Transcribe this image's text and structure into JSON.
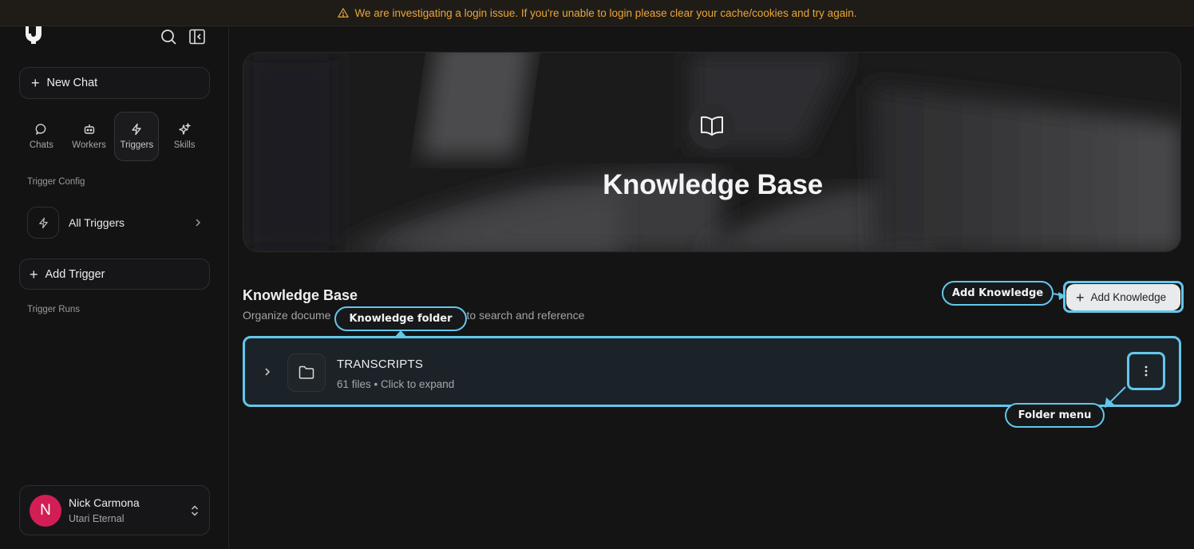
{
  "banner": {
    "icon": "warning-icon",
    "text": "We are investigating a login issue. If you're unable to login please clear your cache/cookies and try again."
  },
  "sidebar": {
    "logo": "brand-logo",
    "new_chat_label": "New Chat",
    "nav": [
      {
        "label": "Chats",
        "icon": "chat-bubble-icon"
      },
      {
        "label": "Workers",
        "icon": "robot-icon"
      },
      {
        "label": "Triggers",
        "icon": "lightning-icon",
        "active": true
      },
      {
        "label": "Skills",
        "icon": "sparkle-icon"
      }
    ],
    "trigger_config_label": "Trigger Config",
    "all_triggers_label": "All Triggers",
    "add_trigger_label": "Add Trigger",
    "trigger_runs_label": "Trigger Runs",
    "user": {
      "initial": "N",
      "name": "Nick Carmona",
      "org": "Utari Eternal",
      "avatar_color": "#d21e55"
    }
  },
  "main": {
    "hero_title": "Knowledge Base",
    "heading": "Knowledge Base",
    "subtitle_start": "Organize docume",
    "subtitle_end": "to search and reference",
    "add_button_label": "Add Knowledge",
    "folder": {
      "name": "TRANSCRIPTS",
      "meta": "61 files • Click to expand"
    }
  },
  "callouts": {
    "knowledge_folder": "Knowledge folder",
    "add_knowledge": "Add Knowledge",
    "folder_menu": "Folder menu"
  },
  "colors": {
    "accent_outline": "#62c7ec",
    "banner_text": "#e9a53a",
    "background": "#141415"
  }
}
